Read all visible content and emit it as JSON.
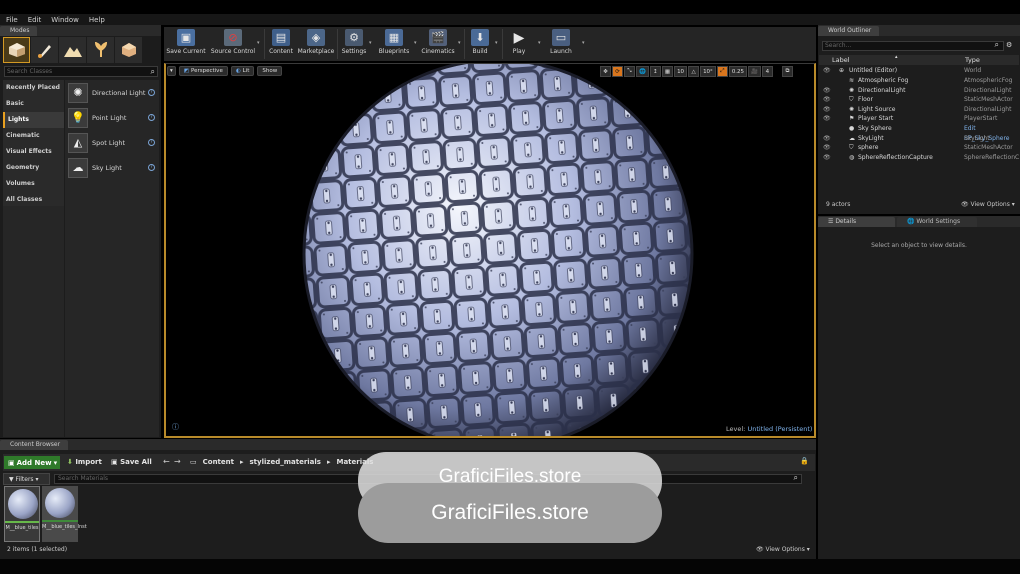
{
  "menu": [
    "File",
    "Edit",
    "Window",
    "Help"
  ],
  "modes": {
    "tab": "Modes",
    "search_placeholder": "Search Classes",
    "categories": [
      "Recently Placed",
      "Basic",
      "Lights",
      "Cinematic",
      "Visual Effects",
      "Geometry",
      "Volumes",
      "All Classes"
    ],
    "active_category": "Lights",
    "items": [
      {
        "label": "Directional Light",
        "icon": "directional-light-icon"
      },
      {
        "label": "Point Light",
        "icon": "point-light-icon"
      },
      {
        "label": "Spot Light",
        "icon": "spot-light-icon"
      },
      {
        "label": "Sky Light",
        "icon": "sky-light-icon"
      }
    ]
  },
  "toolbar": {
    "buttons": [
      {
        "label": "Save Current",
        "icon": "save-icon"
      },
      {
        "label": "Source Control",
        "icon": "source-control-icon"
      },
      {
        "label": "Content",
        "icon": "content-icon"
      },
      {
        "label": "Marketplace",
        "icon": "marketplace-icon"
      },
      {
        "label": "Settings",
        "icon": "settings-icon"
      },
      {
        "label": "Blueprints",
        "icon": "blueprints-icon"
      },
      {
        "label": "Cinematics",
        "icon": "cinematics-icon"
      },
      {
        "label": "Build",
        "icon": "build-icon"
      },
      {
        "label": "Play",
        "icon": "play-icon"
      },
      {
        "label": "Launch",
        "icon": "launch-icon"
      }
    ]
  },
  "viewport": {
    "perspective": "Perspective",
    "lit": "Lit",
    "show": "Show",
    "grid": "10",
    "angle": "10°",
    "scale": "0.25",
    "cam": "4",
    "level_label": "Level:",
    "level_value": "Untitled (Persistent)"
  },
  "outliner": {
    "tab": "World Outliner",
    "search_placeholder": "Search...",
    "col_label": "Label",
    "col_type": "Type",
    "rows": [
      {
        "label": "Untitled (Editor)",
        "type": "World"
      },
      {
        "label": "Atmospheric Fog",
        "type": "AtmosphericFog"
      },
      {
        "label": "DirectionalLight",
        "type": "DirectionalLight"
      },
      {
        "label": "Floor",
        "type": "StaticMeshActor"
      },
      {
        "label": "Light Source",
        "type": "DirectionalLight"
      },
      {
        "label": "Player Start",
        "type": "PlayerStart"
      },
      {
        "label": "Sky Sphere",
        "type": "Edit BP_Sky_Sphere"
      },
      {
        "label": "SkyLight",
        "type": "SkyLight"
      },
      {
        "label": "sphere",
        "type": "StaticMeshActor"
      },
      {
        "label": "SphereReflectionCapture",
        "type": "SphereReflectionC"
      }
    ],
    "count": "9 actors",
    "view_options": "View Options"
  },
  "details": {
    "tab": "Details",
    "tab2": "World Settings",
    "message": "Select an object to view details."
  },
  "content_browser": {
    "tab": "Content Browser",
    "add_new": "Add New",
    "import": "Import",
    "save_all": "Save All",
    "path": [
      "Content",
      "stylized_materials",
      "Materials"
    ],
    "filters": "Filters",
    "search_placeholder": "Search Materials",
    "assets": [
      {
        "label": "M__blue_tiles"
      },
      {
        "label": "M__blue_tiles_Inst"
      }
    ],
    "count": "2 items (1 selected)",
    "view_options": "View Options"
  },
  "watermark": {
    "text": "GraficiFiles.store",
    "text_behind": "GraficiFiles.store"
  },
  "colors": {
    "accent": "#d49a24",
    "viewport_border": "#b88a2a",
    "add_new": "#2f7a2a",
    "link": "#7fb2ea"
  }
}
